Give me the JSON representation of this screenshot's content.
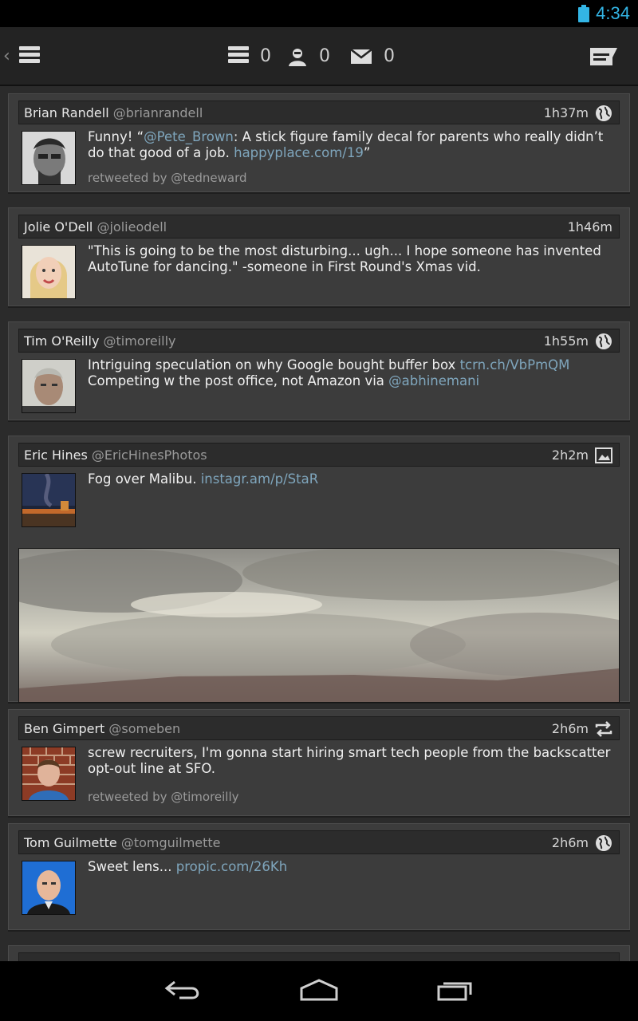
{
  "status": {
    "time": "4:34"
  },
  "actionbar": {
    "counts": {
      "timeline": "0",
      "mentions": "0",
      "messages": "0"
    }
  },
  "colors": {
    "accent": "#33b5e5",
    "link": "#7fa6bd",
    "card": "#3c3c3c"
  },
  "tweets": [
    {
      "name": "Brian Randell",
      "handle": "@brianrandell",
      "time": "1h37m",
      "icon": "globe-icon",
      "parts": [
        "Funny! “",
        "@Pete_Brown",
        ": A stick figure family decal for parents who really didn’t do that good of a job. ",
        "happyplace.com/19",
        "”"
      ],
      "retweeted_by": "retweeted by @tedneward"
    },
    {
      "name": "Jolie O'Dell",
      "handle": "@jolieodell",
      "time": "1h46m",
      "icon": "",
      "parts": [
        "\"This is going to be the most disturbing... ugh... I hope someone has invented AutoTune for dancing.\" -someone in First Round's Xmas vid."
      ],
      "retweeted_by": ""
    },
    {
      "name": "Tim O'Reilly",
      "handle": "@timoreilly",
      "time": "1h55m",
      "icon": "globe-icon",
      "parts": [
        "Intriguing speculation on why Google bought buffer box ",
        "tcrn.ch/VbPmQM",
        " Competing w the post office, not Amazon via ",
        "@abhinemani"
      ],
      "retweeted_by": ""
    },
    {
      "name": "Eric Hines",
      "handle": "@EricHinesPhotos",
      "time": "2h2m",
      "icon": "image-icon",
      "parts": [
        "Fog over Malibu. ",
        "instagr.am/p/StaR"
      ],
      "retweeted_by": ""
    },
    {
      "name": "Ben Gimpert",
      "handle": "@someben",
      "time": "2h6m",
      "icon": "retweet-icon",
      "parts": [
        "screw recruiters, I'm gonna start hiring smart tech people from the backscatter opt-out line at SFO."
      ],
      "retweeted_by": "retweeted by @timoreilly"
    },
    {
      "name": "Tom Guilmette",
      "handle": "@tomguilmette",
      "time": "2h6m",
      "icon": "globe-icon",
      "parts": [
        "Sweet lens... ",
        "propic.com/26Kh"
      ],
      "retweeted_by": ""
    }
  ]
}
